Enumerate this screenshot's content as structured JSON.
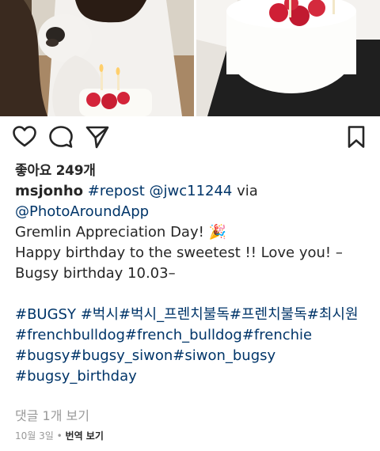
{
  "post": {
    "likes_text": "좋아요 249개",
    "username": "msjonho",
    "caption_segments": [
      {
        "text": " #repost @jwc11244",
        "kind": "link"
      },
      {
        "text": " via\n",
        "kind": "text"
      },
      {
        "text": "@PhotoAroundApp",
        "kind": "link"
      },
      {
        "text": "\nGremlin Appreciation Day! 🎉\nHappy birthday to the sweetest !! Love you! –Bugsy birthday 10.03–\n\n",
        "kind": "text"
      },
      {
        "text": "#BUGSY #벅시#벅시_프렌치불독#프렌치불독#최시원\n#frenchbulldog#french_bulldog#frenchie\n#bugsy#bugsy_siwon#siwon_bugsy\n#bugsy_birthday",
        "kind": "tag"
      }
    ],
    "view_comments": "댓글 1개 보기",
    "date": "10월 3일",
    "separator": "•",
    "translate": "번역 보기"
  },
  "icons": {
    "like": "heart-icon",
    "comment": "comment-bubble-icon",
    "share": "paper-plane-icon",
    "save": "bookmark-icon"
  }
}
